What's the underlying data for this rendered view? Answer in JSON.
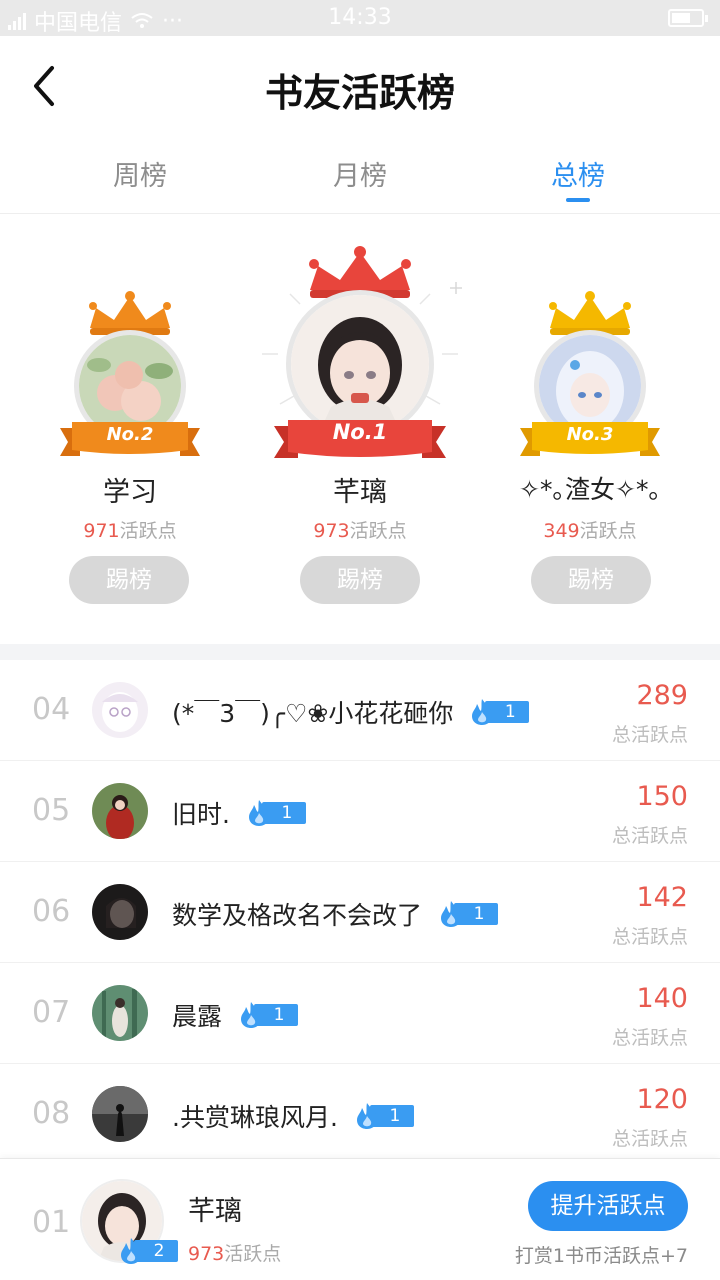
{
  "status_bar": {
    "signal_label": "4G 2G",
    "carrier": "中国电信",
    "dots": "···",
    "time": "14:33"
  },
  "header": {
    "title": "书友活跃榜",
    "back_icon": "chevron-left-icon"
  },
  "tabs": [
    {
      "label": "周榜",
      "active": false
    },
    {
      "label": "月榜",
      "active": false
    },
    {
      "label": "总榜",
      "active": true
    }
  ],
  "podium": {
    "first": {
      "badge": "No.1",
      "name": "芊璃",
      "points": "973",
      "points_suffix": "活跃点",
      "kick_label": "踢榜"
    },
    "second": {
      "badge": "No.2",
      "name": "学习",
      "points": "971",
      "points_suffix": "活跃点",
      "kick_label": "踢榜"
    },
    "third": {
      "badge": "No.3",
      "name": "✧*｡渣女✧*｡",
      "points": "349",
      "points_suffix": "活跃点",
      "kick_label": "踢榜"
    }
  },
  "list": {
    "score_label": "总活跃点",
    "rows": [
      {
        "rank": "04",
        "name": "(*￣3￣)╭♡❀小花花砸你",
        "level": "1",
        "score": "289"
      },
      {
        "rank": "05",
        "name": "旧时.",
        "level": "1",
        "score": "150"
      },
      {
        "rank": "06",
        "name": "数学及格改名不会改了",
        "level": "1",
        "score": "142"
      },
      {
        "rank": "07",
        "name": "晨露",
        "level": "1",
        "score": "140"
      },
      {
        "rank": "08",
        "name": ".共赏琳琅风月.",
        "level": "1",
        "score": "120"
      }
    ]
  },
  "my_rank": {
    "rank": "01",
    "name": "芊璃",
    "level": "2",
    "points": "973",
    "points_suffix": "活跃点",
    "button_label": "提升活跃点",
    "hint": "打赏1书币活跃点+7"
  },
  "colors": {
    "accent": "#2b8ff0",
    "score_red": "#e85a4f",
    "gold": "#f5a623",
    "orange": "#f08a1c",
    "red_ribbon": "#e8453c",
    "level_blue": "#3a9cf2"
  }
}
